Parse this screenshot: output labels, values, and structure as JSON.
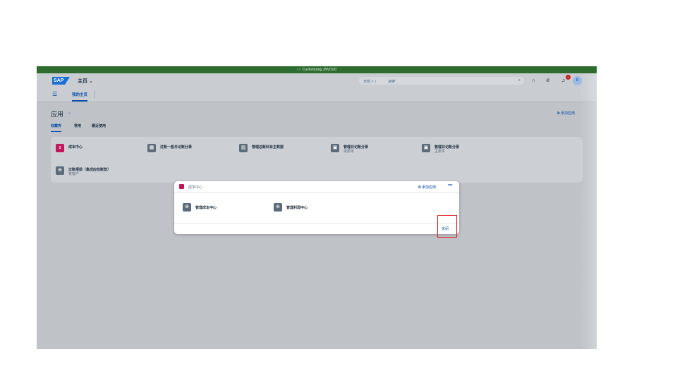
{
  "window": {
    "title": "Customizing  JNV/100",
    "nav_glyph": "‹ ›"
  },
  "shell": {
    "logo_text": "SAP",
    "home_title": "主页 ⌄",
    "search_scope": "全部  ∨  |",
    "search_placeholder": "搜索",
    "icons": [
      "search-icon",
      "headset-icon",
      "help-icon",
      "bell-icon",
      "avatar"
    ],
    "notification_count": "1",
    "avatar_initial": "8"
  },
  "nav": {
    "menu_icon": "☰",
    "home_tab": "我的主页"
  },
  "apps": {
    "title": "应用",
    "add_link": "添加应用",
    "tabs": [
      "收藏夹",
      "常用",
      "最近使用"
    ],
    "tiles": [
      {
        "label": "成本中心",
        "sub": "",
        "icon": "2"
      },
      {
        "label": "过账一般日记账分录",
        "sub": "",
        "icon": "▦"
      },
      {
        "label": "管理总账科目主数据",
        "sub": "",
        "icon": "▥"
      },
      {
        "label": "管理日记账分录",
        "sub": "余额本",
        "icon": "▣"
      },
      {
        "label": "管理日记账分录",
        "sub": "主账本",
        "icon": "▣"
      },
      {
        "label": "过账报损（集成应收账款）",
        "sub": "有客户",
        "icon": "⊕"
      }
    ]
  },
  "dialog": {
    "title": "成本中心",
    "add_link": "添加应用",
    "more": "•••",
    "tiles": [
      {
        "label": "管理成本中心",
        "icon": "⊕"
      },
      {
        "label": "管理利润中心",
        "icon": "⊕"
      }
    ],
    "close_label": "关闭"
  },
  "colors": {
    "header_green": "#2e6b2e",
    "brand_blue": "#1a6fd4",
    "link_blue": "#0b4fa8",
    "accent_pink": "#c2185b",
    "highlight_red": "#e02020",
    "overlay_gray": "#bfc3c8"
  }
}
